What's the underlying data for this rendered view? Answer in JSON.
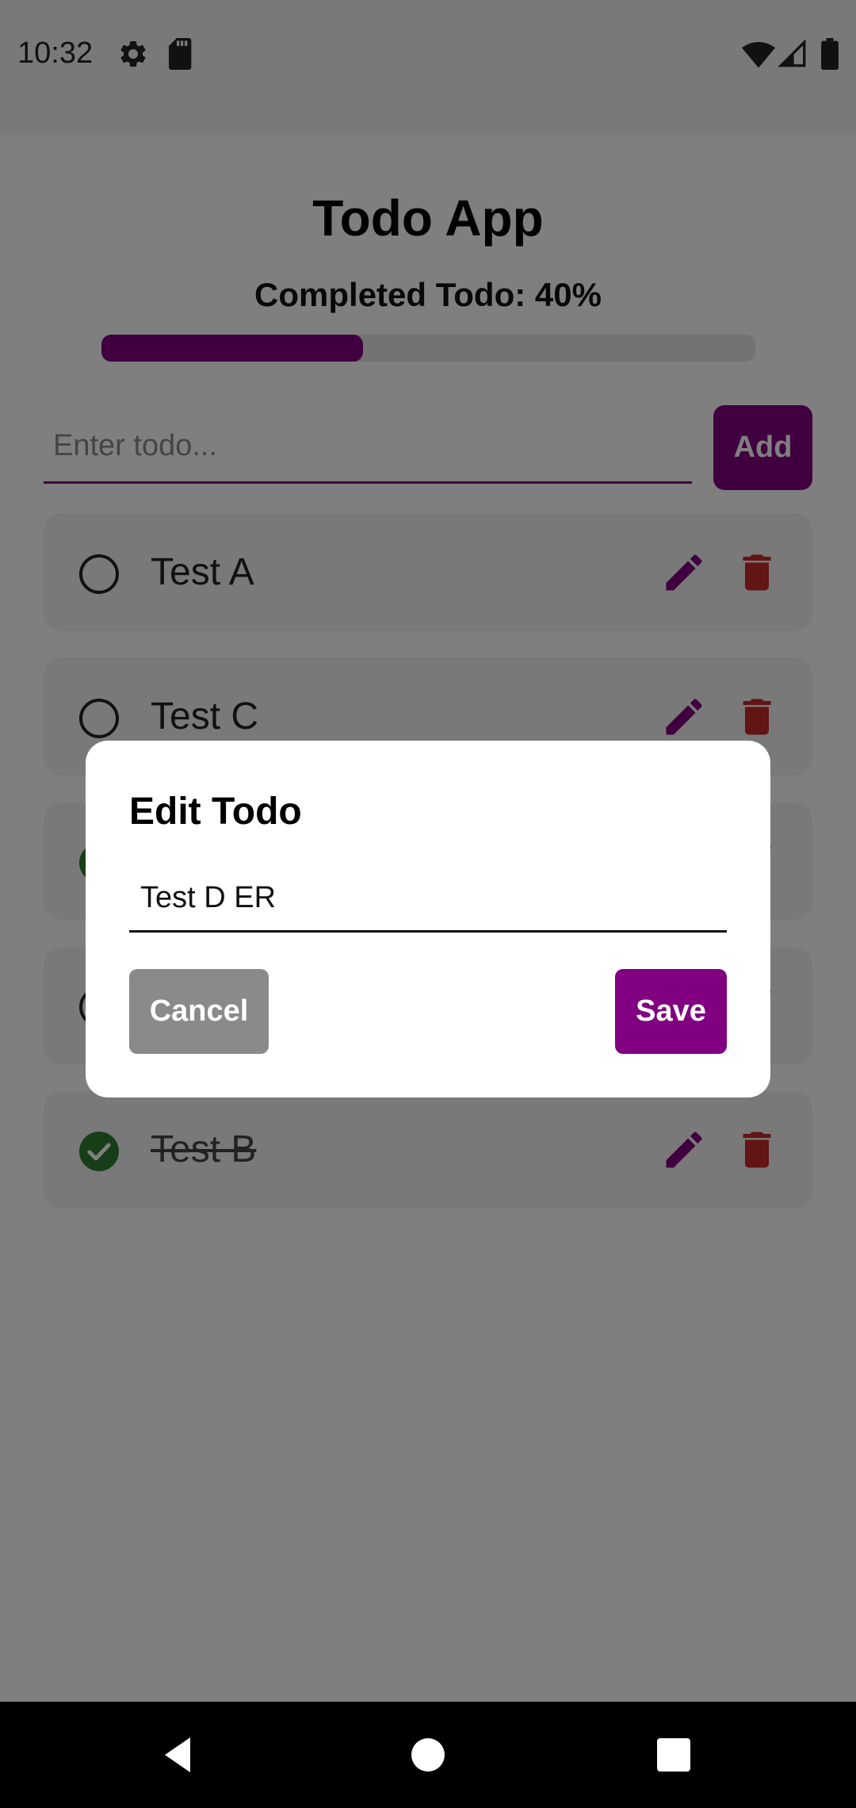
{
  "status_bar": {
    "time": "10:32",
    "left_icons": [
      "gear-icon",
      "sd-card-icon"
    ],
    "right_icons": [
      "wifi-icon",
      "signal-icon",
      "battery-icon"
    ]
  },
  "app": {
    "title": "Todo App",
    "progress_label": "Completed Todo: 40%",
    "progress_value": 0.4,
    "input_placeholder": "Enter todo...",
    "add_label": "Add",
    "todos": [
      {
        "text": "Test A",
        "completed": false
      },
      {
        "text": "Test C",
        "completed": false
      },
      {
        "text": "",
        "completed": true
      },
      {
        "text": "",
        "completed": false
      },
      {
        "text": "Test B",
        "completed": true
      }
    ]
  },
  "dialog": {
    "title": "Edit Todo",
    "input_value": "Test D ER",
    "cancel_label": "Cancel",
    "save_label": "Save"
  },
  "colors": {
    "accent": "#800080",
    "delete": "#c62828",
    "check_done": "#2e7d32"
  },
  "nav_bar": {
    "buttons": [
      "back-icon",
      "home-icon",
      "recents-icon"
    ]
  }
}
